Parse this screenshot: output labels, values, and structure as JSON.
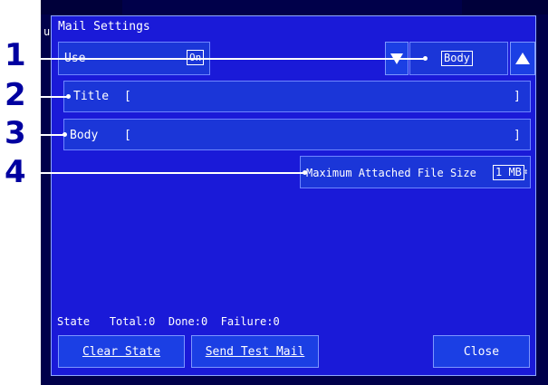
{
  "dialog": {
    "title": "Mail Settings",
    "use": {
      "label": "Use",
      "value": "On"
    },
    "mode_value": "Body",
    "title_row": {
      "label": "Title",
      "open": "[",
      "close": "]"
    },
    "body_row": {
      "label": "Body",
      "open": "[",
      "close": "]"
    },
    "attach": {
      "label": "Maximum Attached File Size",
      "value": "1 MB",
      "spinner": "↕"
    },
    "status": {
      "state": "State",
      "total": "Total:0",
      "done": "Done:0",
      "failure": "Failure:0"
    },
    "buttons": {
      "clear": "Clear State",
      "send": "Send Test Mail",
      "close": "Close"
    }
  },
  "callouts": [
    "1",
    "2",
    "3",
    "4"
  ],
  "background": {
    "left_fragment": "ul"
  },
  "colors": {
    "dialog_bg": "#1a1ad8",
    "accent": "#0000a0",
    "border": "#7d97ff"
  }
}
